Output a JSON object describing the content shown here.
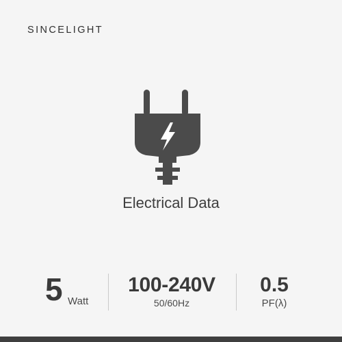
{
  "brand": "SINCELIGHT",
  "icon": "electric-plug-lightning-icon",
  "title": "Electrical Data",
  "specs": [
    {
      "value": "5",
      "unit": "Watt"
    },
    {
      "value": "100-240V",
      "unit": "50/60Hz"
    },
    {
      "value": "0.5",
      "unit": "PF(λ)"
    }
  ],
  "colors": {
    "background": "#f5f5f5",
    "icon": "#4b4b4b",
    "text": "#3e3e3e",
    "bottom_bar": "#3f3f3f"
  }
}
